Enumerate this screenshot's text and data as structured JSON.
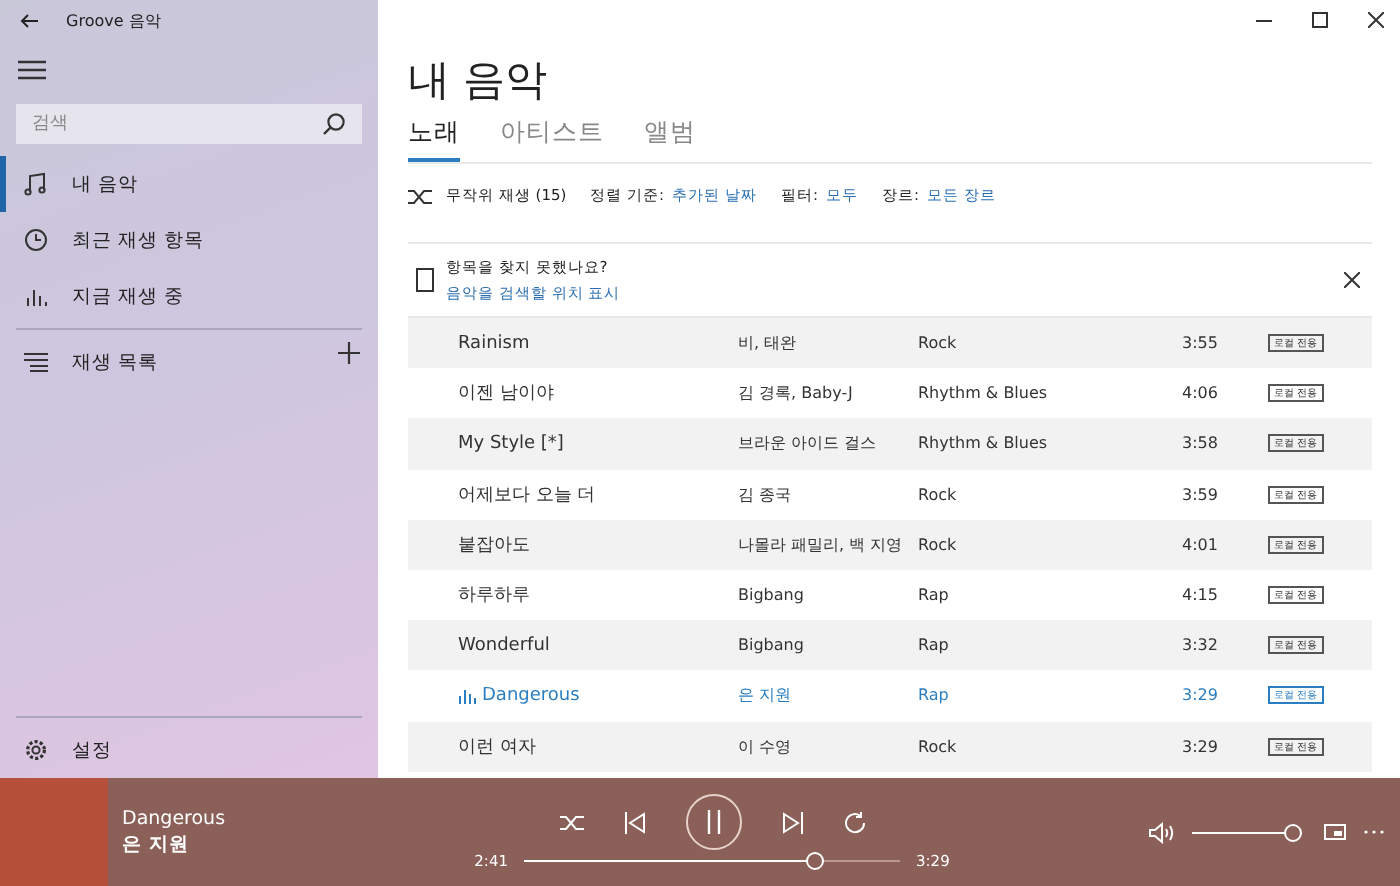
{
  "window": {
    "title": "Groove 음악"
  },
  "sidebar": {
    "search": {
      "placeholder": "검색"
    },
    "items": [
      {
        "label": "내 음악",
        "selected": true
      },
      {
        "label": "최근 재생 항목",
        "selected": false
      },
      {
        "label": "지금 재생 중",
        "selected": false
      }
    ],
    "playlists": {
      "label": "재생 목록"
    },
    "settings": {
      "label": "설정"
    }
  },
  "page": {
    "title": "내 음악",
    "tabs": [
      {
        "label": "노래",
        "selected": true
      },
      {
        "label": "아티스트",
        "selected": false
      },
      {
        "label": "앨범",
        "selected": false
      }
    ],
    "shuffle": "무작위 재생 (15)",
    "filters": [
      {
        "label": "정렬 기준:",
        "value": "추가된 날짜"
      },
      {
        "label": "필터:",
        "value": "모두"
      },
      {
        "label": "장르:",
        "value": "모든 장르"
      }
    ],
    "notice": {
      "title": "항목을 찾지 못했나요?",
      "link": "음악을 검색할 위치 표시"
    }
  },
  "songs": [
    {
      "title": "Rainism",
      "artist": "비, 태완",
      "genre": "Rock",
      "duration": "3:55",
      "badge": "로컬 전용",
      "playing": false
    },
    {
      "title": "이젠 남이야",
      "artist": "김 경록, Baby-J",
      "genre": "Rhythm & Blues",
      "duration": "4:06",
      "badge": "로컬 전용",
      "playing": false
    },
    {
      "title": "My Style [*]",
      "artist": "브라운 아이드 걸스",
      "genre": "Rhythm & Blues",
      "duration": "3:58",
      "badge": "로컬 전용",
      "playing": false
    },
    {
      "title": "어제보다 오늘 더",
      "artist": "김 종국",
      "genre": "Rock",
      "duration": "3:59",
      "badge": "로컬 전용",
      "playing": false
    },
    {
      "title": "붙잡아도",
      "artist": "나몰라 패밀리, 백 지영",
      "genre": "Rock",
      "duration": "4:01",
      "badge": "로컬 전용",
      "playing": false
    },
    {
      "title": "하루하루",
      "artist": "Bigbang",
      "genre": "Rap",
      "duration": "4:15",
      "badge": "로컬 전용",
      "playing": false
    },
    {
      "title": "Wonderful",
      "artist": "Bigbang",
      "genre": "Rap",
      "duration": "3:32",
      "badge": "로컬 전용",
      "playing": false
    },
    {
      "title": "Dangerous",
      "artist": "은 지원",
      "genre": "Rap",
      "duration": "3:29",
      "badge": "로컬 전용",
      "playing": true
    },
    {
      "title": "이런 여자",
      "artist": "이 수영",
      "genre": "Rock",
      "duration": "3:29",
      "badge": "로컬 전용",
      "playing": false
    }
  ],
  "player": {
    "title": "Dangerous",
    "artist": "은 지원",
    "elapsed": "2:41",
    "total": "3:29",
    "progress": {
      "level": 0.77
    },
    "volume": {
      "level": 1.0
    }
  }
}
